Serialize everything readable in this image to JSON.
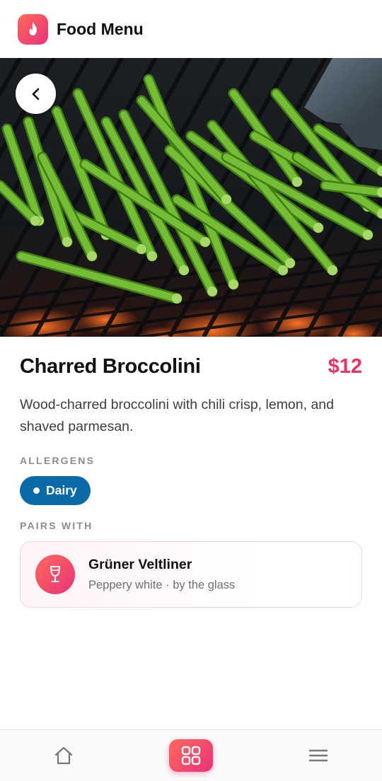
{
  "header": {
    "app_title": "Food Menu",
    "logo_icon": "flame-icon",
    "accent_gradient": [
      "#ff6a5a",
      "#e8327a"
    ]
  },
  "hero": {
    "image_subject": "grilled-greens-photo",
    "back_icon": "chevron-left-icon"
  },
  "dish": {
    "name": "Charred Broccolini",
    "price": "$12",
    "price_color": "#e8325f",
    "description": "Wood-charred broccolini with chili crisp, lemon, and shaved parmesan."
  },
  "allergens": {
    "label": "ALLERGENS",
    "items": [
      {
        "label": "Dairy",
        "color": "#0a6aa6"
      }
    ]
  },
  "pairing": {
    "label": "PAIRS WITH",
    "name": "Grüner Veltliner",
    "subtitle": "Peppery white · by the glass",
    "icon": "wine-glass-icon"
  },
  "bottom_nav": {
    "items": [
      {
        "icon": "home-icon",
        "active": false
      },
      {
        "icon": "grid-icon",
        "active": true
      },
      {
        "icon": "menu-icon",
        "active": false
      }
    ]
  }
}
